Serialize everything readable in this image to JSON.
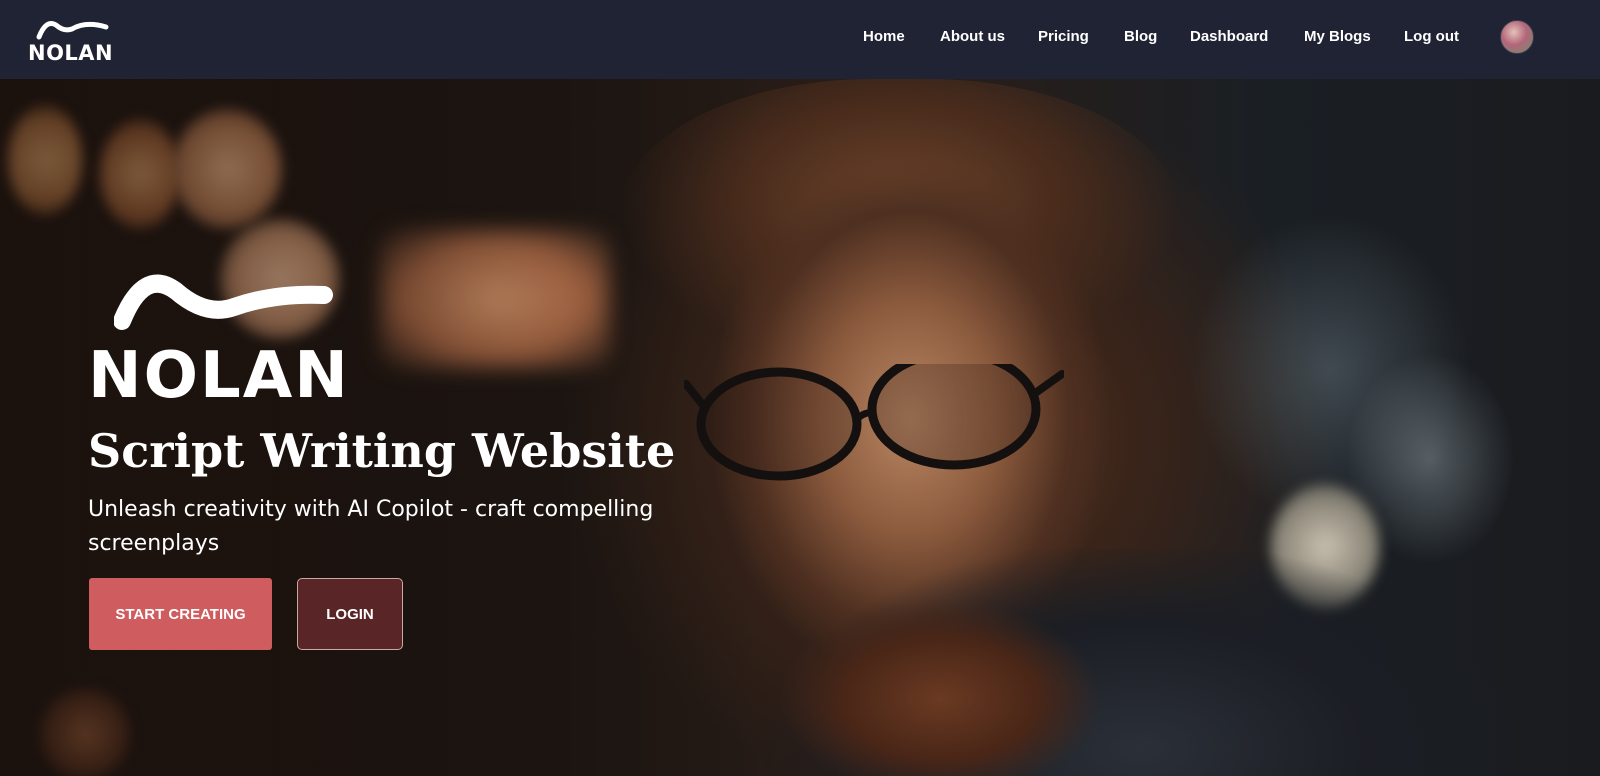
{
  "header": {
    "brand": "NOLAN",
    "nav": [
      {
        "label": "Home"
      },
      {
        "label": "About us"
      },
      {
        "label": "Pricing"
      },
      {
        "label": "Blog"
      },
      {
        "label": "Dashboard"
      },
      {
        "label": "My Blogs"
      },
      {
        "label": "Log out"
      }
    ],
    "avatar_icon": "user-avatar"
  },
  "hero": {
    "logo_text": "NOLAN",
    "title": "Script Writing Website",
    "subtitle": "Unleash creativity with AI Copilot - craft compelling screenplays",
    "start_button": "START CREATING",
    "login_button": "LOGIN"
  },
  "colors": {
    "header_bg": "#1f2333",
    "primary_button": "#cf5d60",
    "secondary_button": "#5a2526"
  }
}
